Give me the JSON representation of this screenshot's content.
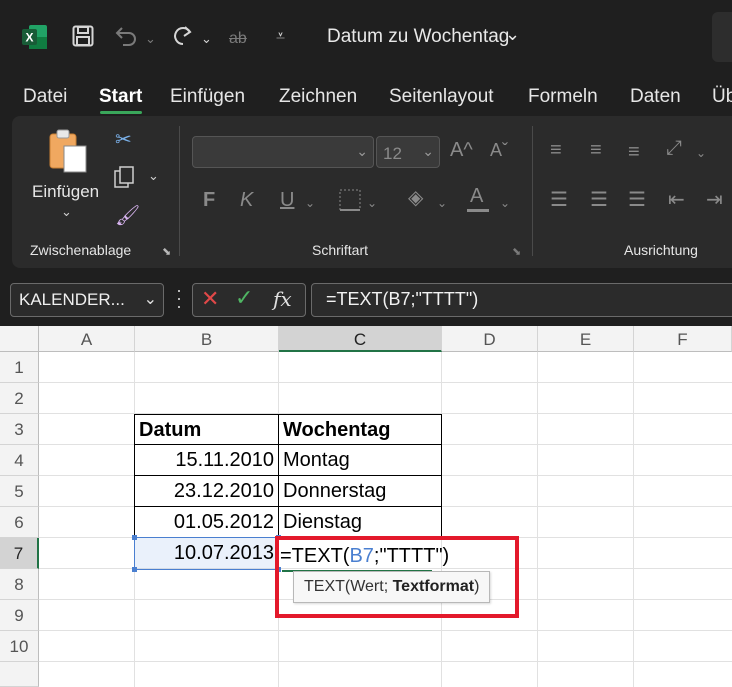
{
  "titlebar": {
    "doc_title": "Datum zu Wochentag",
    "strike_label": "ab",
    "icons": [
      "excel-logo-icon",
      "save-icon",
      "undo-icon",
      "redo-icon",
      "strikethrough-icon",
      "customize-qat-icon"
    ]
  },
  "menu": {
    "tabs": [
      "Datei",
      "Start",
      "Einfügen",
      "Zeichnen",
      "Seitenlayout",
      "Formeln",
      "Daten",
      "Üb"
    ],
    "active": "Start"
  },
  "ribbon": {
    "clipboard": {
      "paste_label": "Einfügen",
      "group_label": "Zwischenablage"
    },
    "font": {
      "font_size": "12",
      "bold": "F",
      "italic": "K",
      "underline": "U",
      "font_color_letter": "A",
      "group_label": "Schriftart"
    },
    "alignment": {
      "group_label": "Ausrichtung"
    }
  },
  "formula_bar": {
    "name_box": "KALENDER...",
    "fx_label": "fx",
    "formula": "=TEXT(B7;\"TTTT\")"
  },
  "sheet": {
    "columns": [
      "A",
      "B",
      "C",
      "D",
      "E",
      "F"
    ],
    "selected_column": "C",
    "rows": [
      "1",
      "2",
      "3",
      "4",
      "5",
      "6",
      "7",
      "8",
      "9",
      "10"
    ],
    "selected_row": "7",
    "table": {
      "headers": [
        "Datum",
        "Wochentag"
      ],
      "rows": [
        [
          "15.11.2010",
          "Montag"
        ],
        [
          "23.12.2010",
          "Donnerstag"
        ],
        [
          "01.05.2012",
          "Dienstag"
        ]
      ],
      "edit_row_date": "10.07.2013"
    },
    "edit_formula": {
      "prefix": "=TEXT(",
      "ref": "B7",
      "suffix": ";\"TTTT\")"
    },
    "tooltip": {
      "func": "TEXT(Wert; ",
      "arg": "Textformat",
      "close": ")"
    }
  },
  "colors": {
    "accent": "#217346",
    "highlight_border": "#e3192b",
    "ref_blue": "#4a7fd0"
  }
}
